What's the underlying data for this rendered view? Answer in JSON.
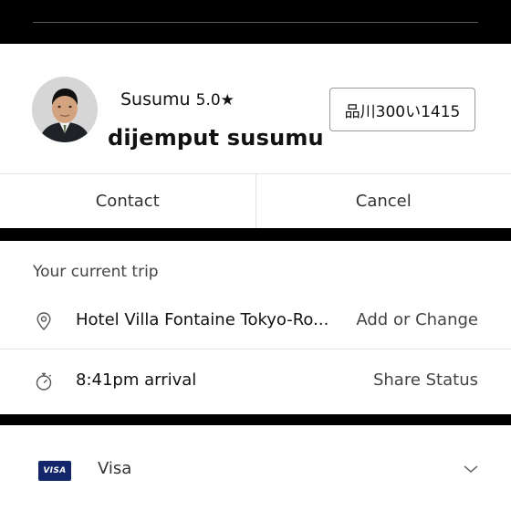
{
  "driver": {
    "name": "Susumu",
    "rating": "5.0★",
    "status": "dijemput susumu",
    "plate": "品川300い1415",
    "avatar_icon": "driver-photo"
  },
  "actions": {
    "contact_label": "Contact",
    "cancel_label": "Cancel"
  },
  "trip": {
    "header": "Your current trip",
    "destination": "Hotel Villa Fontaine Tokyo-Ro...",
    "destination_action": "Add or Change",
    "destination_icon": "location-pin-icon",
    "arrival": "8:41pm arrival",
    "arrival_action": "Share Status",
    "arrival_icon": "stopwatch-icon"
  },
  "payment": {
    "logo_text": "VISA",
    "method": "Visa",
    "chevron_icon": "chevron-down-icon"
  },
  "colors": {
    "band": "#000000",
    "visa_blue": "#14276b",
    "divider": "#e2e2e2"
  }
}
